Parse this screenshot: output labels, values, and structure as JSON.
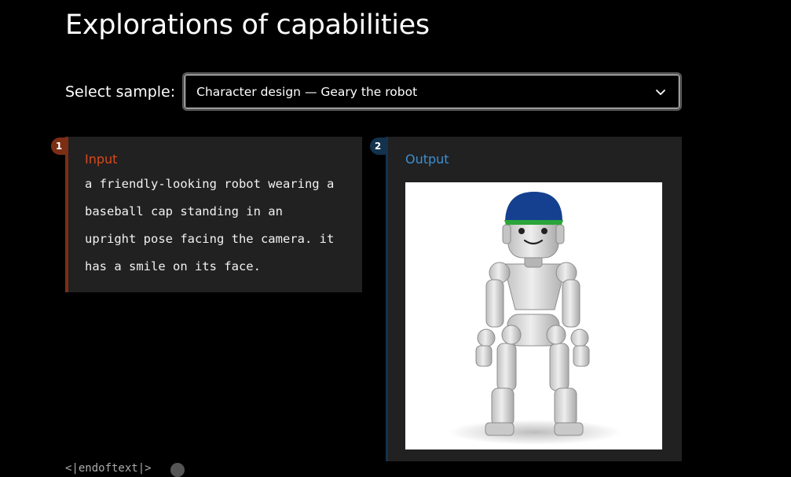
{
  "page": {
    "title": "Explorations of capabilities"
  },
  "sample_select": {
    "label": "Select sample:",
    "value": "Character design — Geary the robot",
    "chevron_icon": "chevron-down-icon"
  },
  "input_panel": {
    "step": "1",
    "label": "Input",
    "prompt": "a friendly-looking robot wearing a\nbaseball cap standing in an\nupright pose facing the camera. it\nhas a smile on its face.",
    "accent": "#d9491d"
  },
  "output_panel": {
    "step": "2",
    "label": "Output",
    "image_icon": "robot-image",
    "accent": "#3d8fd1"
  },
  "footer": {
    "snippet": "<|endoftext|>"
  }
}
